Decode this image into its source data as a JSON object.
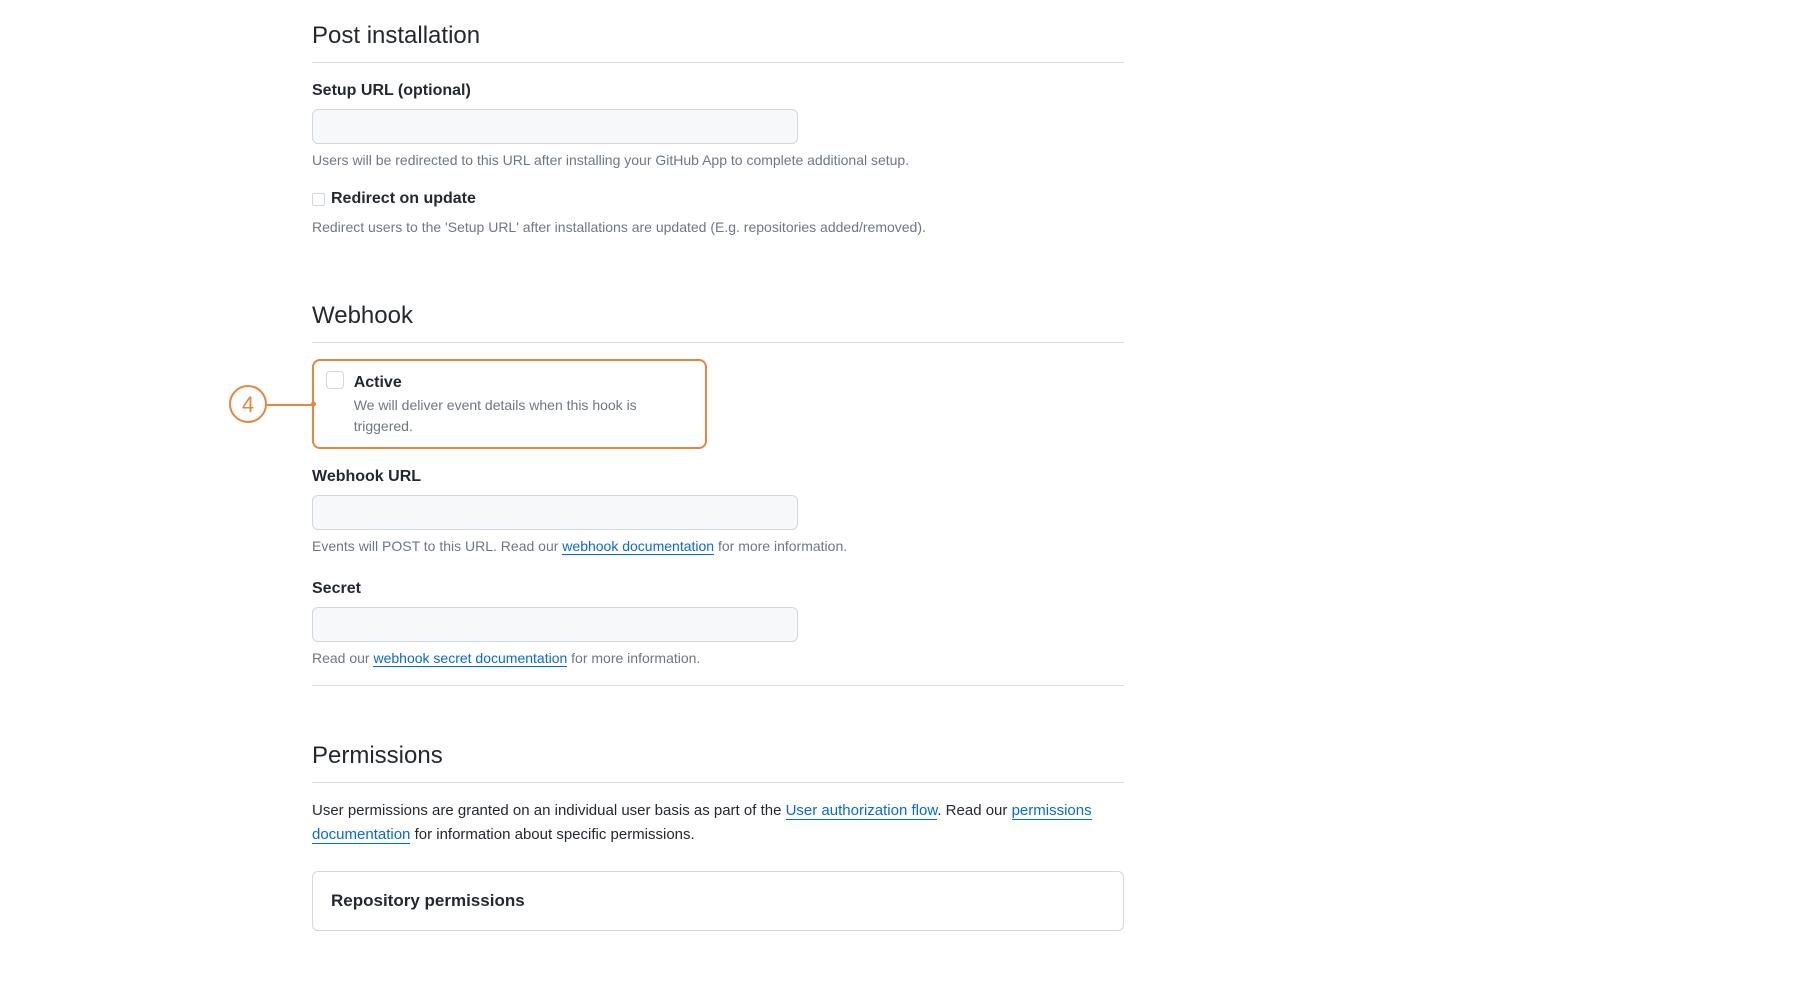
{
  "post_installation": {
    "heading": "Post installation",
    "setup_url": {
      "label": "Setup URL (optional)",
      "value": "",
      "help": "Users will be redirected to this URL after installing your GitHub App to complete additional setup."
    },
    "redirect_on_update": {
      "label": "Redirect on update",
      "help": "Redirect users to the 'Setup URL' after installations are updated (E.g. repositories added/removed)."
    }
  },
  "webhook": {
    "heading": "Webhook",
    "callout_number": "4",
    "active": {
      "label": "Active",
      "description": "We will deliver event details when this hook is triggered."
    },
    "webhook_url": {
      "label": "Webhook URL",
      "value": "",
      "help_prefix": "Events will POST to this URL. Read our ",
      "help_link": "webhook documentation",
      "help_suffix": " for more information."
    },
    "secret": {
      "label": "Secret",
      "value": "",
      "help_prefix": "Read our ",
      "help_link": "webhook secret documentation",
      "help_suffix": " for more information."
    }
  },
  "permissions": {
    "heading": "Permissions",
    "para_prefix": "User permissions are granted on an individual user basis as part of the ",
    "para_link1": "User authorization flow",
    "para_mid": ". Read our ",
    "para_link2": "permissions documentation",
    "para_suffix": " for information about specific permissions.",
    "repo_permissions_label": "Repository permissions"
  }
}
